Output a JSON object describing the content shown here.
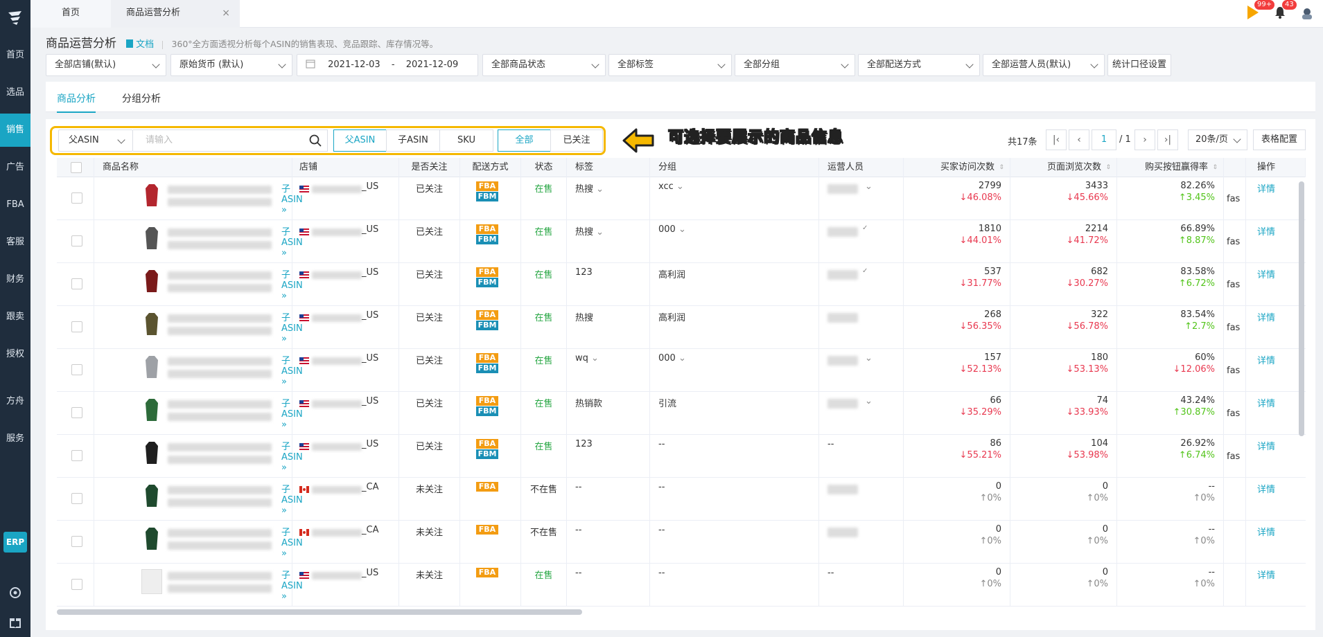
{
  "sidebar": {
    "items": [
      "首页",
      "选品",
      "销售",
      "广告",
      "FBA",
      "客服",
      "财务",
      "跟卖",
      "授权",
      "方舟",
      "服务"
    ],
    "active": "销售",
    "erp": "ERP"
  },
  "tabs": {
    "home": "首页",
    "current": "商品运营分析",
    "close": "×"
  },
  "notifications": {
    "announce_badge": "99+",
    "bell_badge": "43"
  },
  "header": {
    "title": "商品运营分析",
    "doc_label": "文档",
    "description": "360°全方面透视分析每个ASIN的销售表现、竞品跟踪、库存情况等。"
  },
  "filters": {
    "store": "全部店铺(默认)",
    "currency": "原始货币 (默认)",
    "date_start": "2021-12-03",
    "date_sep": "-",
    "date_end": "2021-12-09",
    "status": "全部商品状态",
    "tag": "全部标签",
    "group": "全部分组",
    "shipping": "全部配送方式",
    "operator": "全部运营人员(默认)",
    "stat_config": "统计口径设置"
  },
  "content_tabs": [
    "商品分析",
    "分组分析"
  ],
  "toolbar": {
    "asin_select": "父ASIN",
    "search_placeholder": "请输入",
    "level_buttons": [
      "父ASIN",
      "子ASIN",
      "SKU"
    ],
    "follow_buttons": [
      "全部",
      "已关注"
    ],
    "annotation": "可选择要展示的商品信息",
    "total": "共17条",
    "page_current": "1",
    "page_of": "/ 1",
    "per_page": "20条/页",
    "table_config": "表格配置"
  },
  "columns": [
    "商品名称",
    "店铺",
    "是否关注",
    "配送方式",
    "状态",
    "标签",
    "分组",
    "运营人员",
    "买家访问次数",
    "页面浏览次数",
    "购买按钮赢得率",
    "操作"
  ],
  "rows": [
    {
      "sub": "子ASIN",
      "store": "_US",
      "country": "us",
      "follow": "已关注",
      "ship": [
        "FBA",
        "FBM"
      ],
      "status": "在售",
      "tag": "热搜",
      "tagdrop": true,
      "group": "xcc",
      "groupdrop": true,
      "op": "blur",
      "opdrop": "down",
      "visits": "2799",
      "visits_chg": "↓46.08%",
      "views": "3433",
      "views_chg": "↓45.66%",
      "bb": "82.26%",
      "bb_chg": "↑3.45%",
      "bb_dir": "up",
      "extra": "fas",
      "action": "详情",
      "thumb": "red"
    },
    {
      "sub": "子ASIN",
      "store": "_US",
      "country": "us",
      "follow": "已关注",
      "ship": [
        "FBA",
        "FBM"
      ],
      "status": "在售",
      "tag": "热搜",
      "tagdrop": true,
      "group": "000",
      "groupdrop": true,
      "op": "blur",
      "opdrop": "check",
      "visits": "1810",
      "visits_chg": "↓44.01%",
      "views": "2214",
      "views_chg": "↓41.72%",
      "bb": "66.89%",
      "bb_chg": "↑8.87%",
      "bb_dir": "up",
      "extra": "fas",
      "action": "详情",
      "thumb": "grey"
    },
    {
      "sub": "子ASIN",
      "store": "_US",
      "country": "us",
      "follow": "已关注",
      "ship": [
        "FBA",
        "FBM"
      ],
      "status": "在售",
      "tag": "123",
      "tagdrop": false,
      "group": "高利润",
      "groupdrop": false,
      "op": "blur",
      "opdrop": "check",
      "visits": "537",
      "visits_chg": "↓31.77%",
      "views": "682",
      "views_chg": "↓30.27%",
      "bb": "83.58%",
      "bb_chg": "↑6.72%",
      "bb_dir": "up",
      "extra": "fas",
      "action": "详情",
      "thumb": "darkred"
    },
    {
      "sub": "子ASIN",
      "store": "_US",
      "country": "us",
      "follow": "已关注",
      "ship": [
        "FBA",
        "FBM"
      ],
      "status": "在售",
      "tag": "热搜",
      "tagdrop": false,
      "group": "高利润",
      "groupdrop": false,
      "op": "blur",
      "opdrop": "",
      "visits": "268",
      "visits_chg": "↓56.35%",
      "views": "322",
      "views_chg": "↓56.78%",
      "bb": "83.54%",
      "bb_chg": "↑2.7%",
      "bb_dir": "up",
      "extra": "fas",
      "action": "详情",
      "thumb": "olive"
    },
    {
      "sub": "子ASIN",
      "store": "_US",
      "country": "us",
      "follow": "已关注",
      "ship": [
        "FBA",
        "FBM"
      ],
      "status": "在售",
      "tag": "wq",
      "tagdrop": true,
      "group": "000",
      "groupdrop": true,
      "op": "blur",
      "opdrop": "down",
      "visits": "157",
      "visits_chg": "↓52.13%",
      "views": "180",
      "views_chg": "↓53.13%",
      "bb": "60%",
      "bb_chg": "↓12.06%",
      "bb_dir": "down",
      "extra": "fas",
      "action": "详情",
      "thumb": "lightgrey"
    },
    {
      "sub": "子ASIN",
      "store": "_US",
      "country": "us",
      "follow": "已关注",
      "ship": [
        "FBA",
        "FBM"
      ],
      "status": "在售",
      "tag": "热销款",
      "tagdrop": false,
      "group": "引流",
      "groupdrop": false,
      "op": "blur",
      "opdrop": "down",
      "visits": "66",
      "visits_chg": "↓35.29%",
      "views": "74",
      "views_chg": "↓33.93%",
      "bb": "43.24%",
      "bb_chg": "↑30.87%",
      "bb_dir": "up",
      "extra": "fas",
      "action": "详情",
      "thumb": "green"
    },
    {
      "sub": "子ASIN",
      "store": "_US",
      "country": "us",
      "follow": "已关注",
      "ship": [
        "FBA",
        "FBM"
      ],
      "status": "在售",
      "tag": "123",
      "tagdrop": false,
      "group": "--",
      "groupdrop": false,
      "op": "--",
      "opdrop": "",
      "visits": "86",
      "visits_chg": "↓55.21%",
      "views": "104",
      "views_chg": "↓53.98%",
      "bb": "26.92%",
      "bb_chg": "↑6.74%",
      "bb_dir": "up",
      "extra": "fas",
      "action": "详情",
      "thumb": "black"
    },
    {
      "sub": "子ASIN",
      "store": "_CA",
      "country": "ca",
      "follow": "未关注",
      "ship": [
        "FBA"
      ],
      "status": "不在售",
      "tag": "--",
      "tagdrop": false,
      "group": "--",
      "groupdrop": false,
      "op": "blur",
      "opdrop": "",
      "visits": "0",
      "visits_chg": "↑0%",
      "views": "0",
      "views_chg": "↑0%",
      "bb": "--",
      "bb_chg": "↑0%",
      "bb_dir": "grey",
      "extra": "",
      "action": "详情",
      "thumb": "darkgreen"
    },
    {
      "sub": "子ASIN",
      "store": "_CA",
      "country": "ca",
      "follow": "未关注",
      "ship": [
        "FBA"
      ],
      "status": "不在售",
      "tag": "--",
      "tagdrop": false,
      "group": "--",
      "groupdrop": false,
      "op": "blur",
      "opdrop": "",
      "visits": "0",
      "visits_chg": "↑0%",
      "views": "0",
      "views_chg": "↑0%",
      "bb": "--",
      "bb_chg": "↑0%",
      "bb_dir": "grey",
      "extra": "",
      "action": "详情",
      "thumb": "darkgreen"
    },
    {
      "sub": "子ASIN",
      "store": "_US",
      "country": "us",
      "follow": "未关注",
      "ship": [
        "FBA"
      ],
      "status": "在售",
      "tag": "--",
      "tagdrop": false,
      "group": "--",
      "groupdrop": false,
      "op": "--",
      "opdrop": "",
      "visits": "0",
      "visits_chg": "↑0%",
      "views": "0",
      "views_chg": "↑0%",
      "bb": "--",
      "bb_chg": "↑0%",
      "bb_dir": "grey",
      "extra": "",
      "action": "详情",
      "thumb": "placeholder"
    }
  ],
  "colors": {
    "accent": "#1aa5c4",
    "sidebar": "#1f2d3d",
    "fba": "#f39c12",
    "fbm": "#1a8fb5",
    "down": "#e8384f",
    "up": "#52c41a",
    "annotation": "#f5b800"
  }
}
